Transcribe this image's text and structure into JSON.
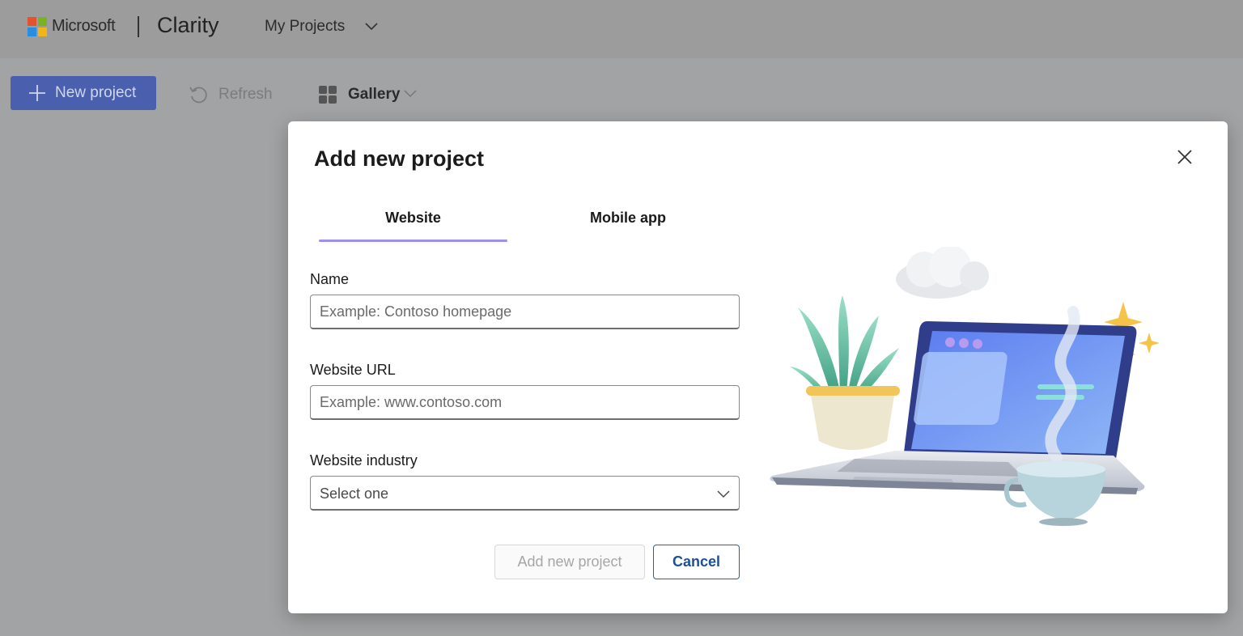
{
  "header": {
    "brand": "Microsoft",
    "product": "Clarity",
    "projects_menu": "My Projects",
    "chevron_icon": "chevron-down-icon"
  },
  "toolbar": {
    "new_project_label": "New project",
    "refresh_label": "Refresh",
    "gallery_label": "Gallery"
  },
  "modal": {
    "title": "Add new project",
    "tabs": [
      {
        "label": "Website",
        "selected": true
      },
      {
        "label": "Mobile app",
        "selected": false
      }
    ],
    "fields": {
      "name": {
        "label": "Name",
        "placeholder": "Example: Contoso homepage",
        "value": ""
      },
      "url": {
        "label": "Website URL",
        "placeholder": "Example: www.contoso.com",
        "value": ""
      },
      "industry": {
        "label": "Website industry",
        "selected": "Select one"
      }
    },
    "buttons": {
      "add": "Add new project",
      "cancel": "Cancel"
    },
    "close_icon": "close-icon"
  },
  "colors": {
    "accent": "#4a5fae",
    "tab_underline": "#9b8ff0",
    "cancel_border": "#2a5fa8",
    "overlay": "#a2a3a4"
  }
}
